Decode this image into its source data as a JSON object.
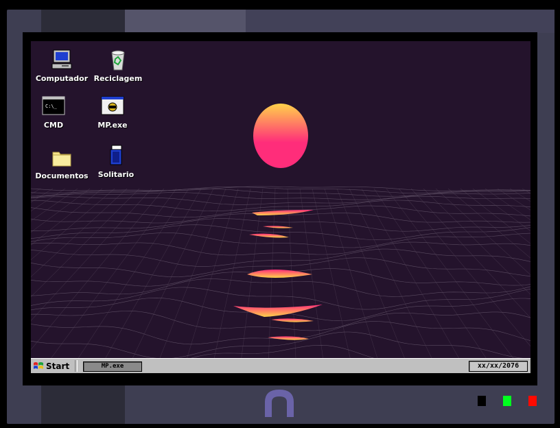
{
  "desktop": {
    "icons": [
      {
        "label": "Computador",
        "icon": "computer-icon"
      },
      {
        "label": "Reciclagem",
        "icon": "recycle-bin-icon"
      },
      {
        "label": "CMD",
        "icon": "cmd-icon",
        "prompt": "C:\\_"
      },
      {
        "label": "MP.exe",
        "icon": "media-player-icon"
      },
      {
        "label": "Documentos",
        "icon": "folder-icon"
      },
      {
        "label": "Solitario",
        "icon": "solitaire-icon"
      }
    ]
  },
  "wallpaper": {
    "sun_top_color": "#ffd24a",
    "sun_bottom_color": "#ff2d7a",
    "sky_color": "#24132c",
    "grid_color": "#6e5f74"
  },
  "taskbar": {
    "start_label": "Start",
    "active_task": "MP.exe",
    "clock": "xx/xx/2076"
  },
  "hardware": {
    "led_colors": [
      "#000000",
      "#00ff1e",
      "#ff0a00"
    ]
  }
}
